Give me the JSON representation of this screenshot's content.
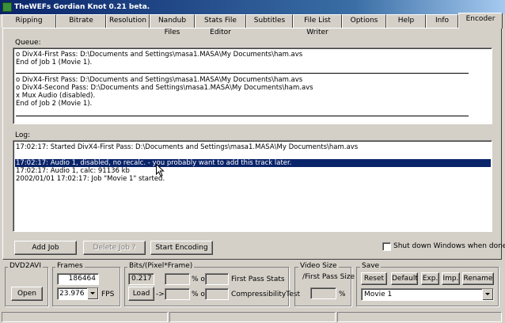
{
  "window": {
    "title": "TheWEFs Gordian Knot 0.21 beta."
  },
  "tabs": [
    "Ripping",
    "Bitrate",
    "Resolution",
    "Nandub Files",
    "Stats File Editor",
    "Subtitles",
    "File List Writer",
    "Options",
    "Help",
    "Info",
    "Encoder"
  ],
  "queue": {
    "label": "Queue:",
    "job1": [
      "o  DivX4-First Pass:  D:\\Documents and Settings\\masa1.MASA\\My Documents\\ham.avs",
      "End of Job 1 (Movie 1)."
    ],
    "job2": [
      "o  DivX4-First Pass:  D:\\Documents and Settings\\masa1.MASA\\My Documents\\ham.avs",
      "o  DivX4-Second Pass:  D:\\Documents and Settings\\masa1.MASA\\My Documents\\ham.avs",
      "x  Mux Audio (disabled).",
      "End of Job 2 (Movie 1)."
    ]
  },
  "log": {
    "label": "Log:",
    "line1": "17:02:17: Started  DivX4-First Pass: D:\\Documents and Settings\\masa1.MASA\\My Documents\\ham.avs",
    "selected": "17:02:17: Audio 1, disabled, no recalc. - you probably want to add this track later.",
    "line3": "17:02:17: Audio 1, calc:       91136 kb",
    "line4": "2002/01/01 17:02:17: Job \"Movie 1\" started."
  },
  "buttons": {
    "add_job": "Add Job",
    "delete_job": "Delete Job ?",
    "start_encoding": "Start Encoding"
  },
  "shutdown_label": "Shut down Windows when done.",
  "dvd2avi": {
    "title": "DVD2AVI",
    "open": "Open"
  },
  "frames": {
    "title": "Frames",
    "count": "186464",
    "fps": "23.976",
    "fps_label": "FPS"
  },
  "bpf": {
    "title": "Bits/(Pixel*Frame)",
    "value": "0.217",
    "load": "Load",
    "arrow": "->",
    "pct_of_1": "% of",
    "pct_of_2": "% of",
    "first_pass_stats": "First Pass Stats",
    "compressibility_test": "CompressibilityTest"
  },
  "video_size": {
    "title": "Video Size",
    "subtitle": "/First Pass Size",
    "unit": "%"
  },
  "save": {
    "title": "Save",
    "reset": "Reset",
    "default": "Default",
    "exp": "Exp.",
    "imp": "Imp.",
    "rename": "Rename",
    "profile": "Movie 1"
  }
}
